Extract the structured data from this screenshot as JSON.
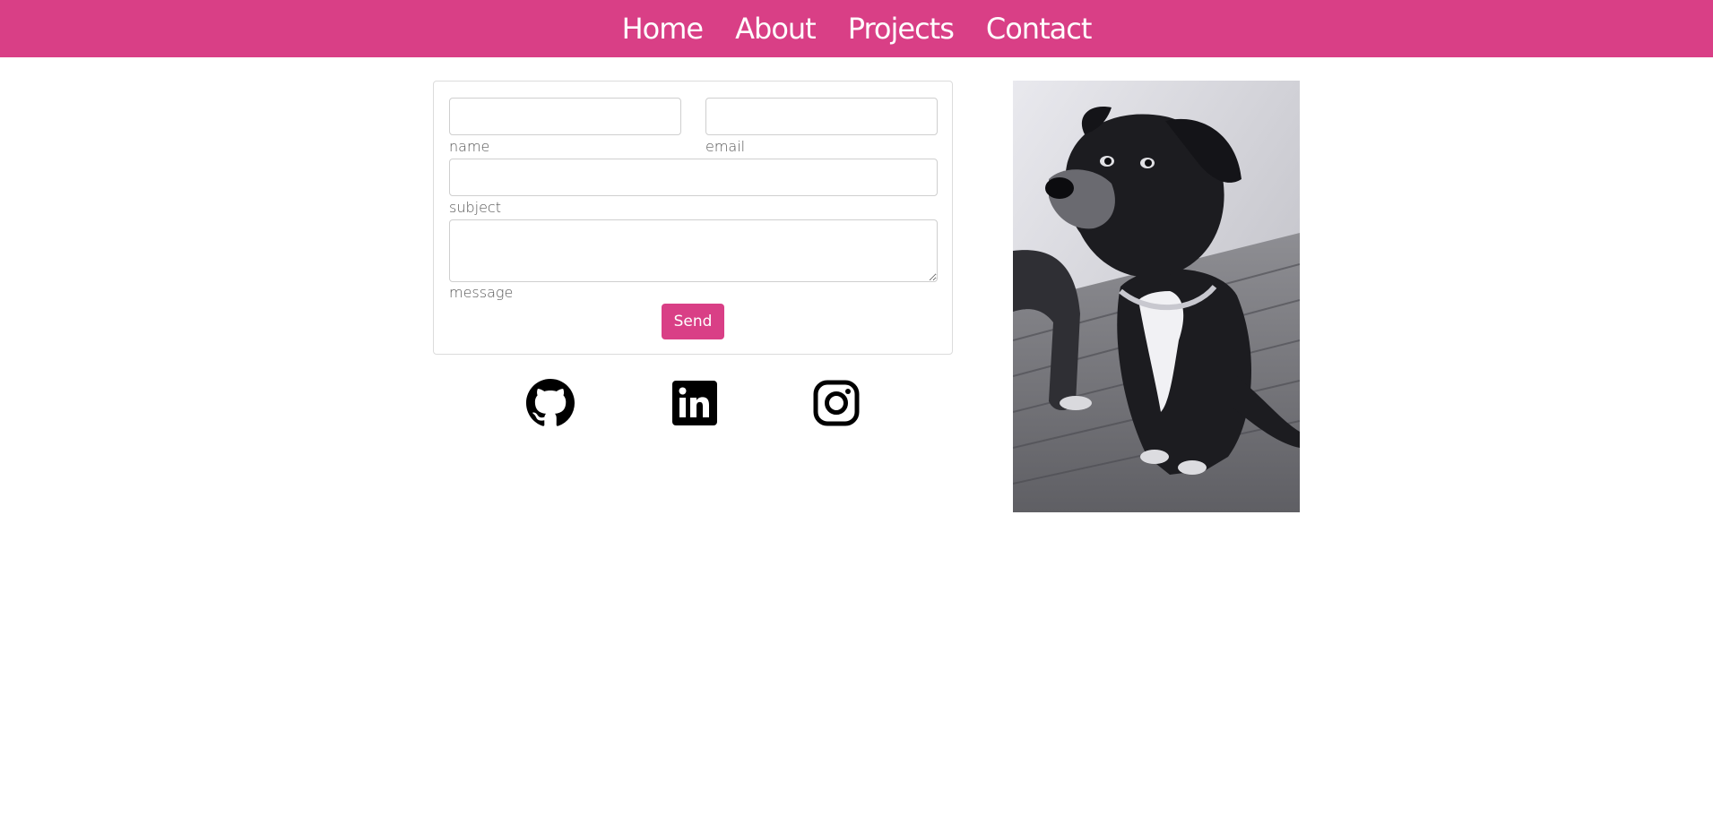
{
  "nav": {
    "items": [
      {
        "label": "Home"
      },
      {
        "label": "About"
      },
      {
        "label": "Projects"
      },
      {
        "label": "Contact"
      }
    ]
  },
  "form": {
    "name_label": "name",
    "email_label": "email",
    "subject_label": "subject",
    "message_label": "message",
    "name_value": "",
    "email_value": "",
    "subject_value": "",
    "message_value": "",
    "send_label": "Send"
  },
  "social": [
    {
      "icon": "github-icon"
    },
    {
      "icon": "linkedin-icon"
    },
    {
      "icon": "instagram-icon"
    }
  ],
  "photo": {
    "subject": "dog-photo"
  },
  "colors": {
    "accent": "#d93f86",
    "nav_text": "#ffffff",
    "label_text": "#555555"
  }
}
